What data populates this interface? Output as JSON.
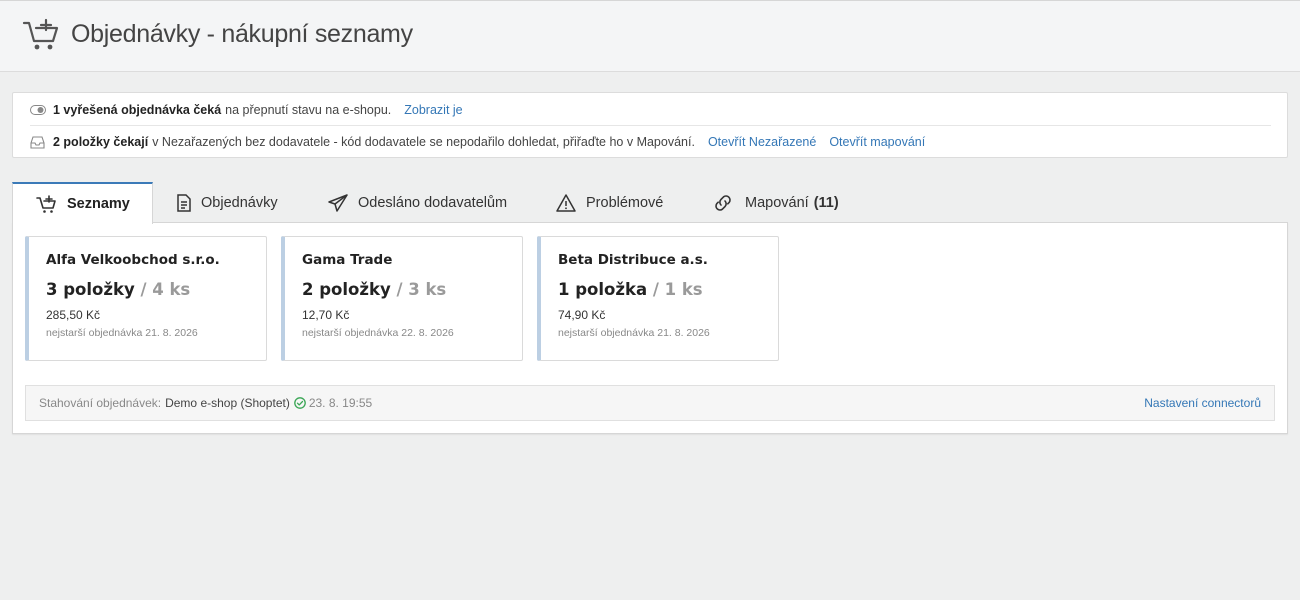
{
  "header": {
    "title": "Objednávky - nákupní seznamy",
    "icon": "cart-plus-icon"
  },
  "notices": [
    {
      "icon": "toggle-icon",
      "bold": "1 vyřešená objednávka čeká",
      "text": "na přepnutí stavu na e-shopu.",
      "links": [
        "Zobrazit je"
      ]
    },
    {
      "icon": "inbox-icon",
      "bold": "2 položky čekají",
      "text": "v Nezařazených bez dodavatele - kód dodavatele se nepodařilo dohledat, přiřaďte ho v Mapování.",
      "links": [
        "Otevřít Nezařazené",
        "Otevřít mapování"
      ]
    }
  ],
  "tabs": [
    {
      "label": "Seznamy",
      "icon": "cart-plus-icon",
      "active": true
    },
    {
      "label": "Objednávky",
      "icon": "document-icon",
      "active": false
    },
    {
      "label": "Odesláno dodavatelům",
      "icon": "paper-plane-icon",
      "active": false
    },
    {
      "label": "Problémové",
      "icon": "warning-icon",
      "active": false
    },
    {
      "label": "Mapování",
      "count": "(11)",
      "icon": "link-icon",
      "active": false
    }
  ],
  "cards": [
    {
      "name": "Alfa Velkoobchod s.r.o.",
      "items": "3 položky",
      "pieces": "/ 4 ks",
      "price": "285,50 Kč",
      "oldest": "nejstarší objednávka 21. 8. 2026"
    },
    {
      "name": "Gama Trade",
      "items": "2 položky",
      "pieces": "/ 3 ks",
      "price": "12,70 Kč",
      "oldest": "nejstarší objednávka 22. 8. 2026"
    },
    {
      "name": "Beta Distribuce a.s.",
      "items": "1 položka",
      "pieces": "/ 1 ks",
      "price": "74,90 Kč",
      "oldest": "nejstarší objednávka 21. 8. 2026"
    }
  ],
  "footer": {
    "label": "Stahování objednávek:",
    "shop": "Demo e-shop (Shoptet)",
    "status_icon": "check-circle-icon",
    "status_color": "#3aa655",
    "time": "23. 8. 19:55",
    "settings_link": "Nastavení connectorů"
  },
  "colors": {
    "link": "#3477b6",
    "active_tab_border": "#3b7ab8",
    "card_accent": "#bccfe3"
  }
}
